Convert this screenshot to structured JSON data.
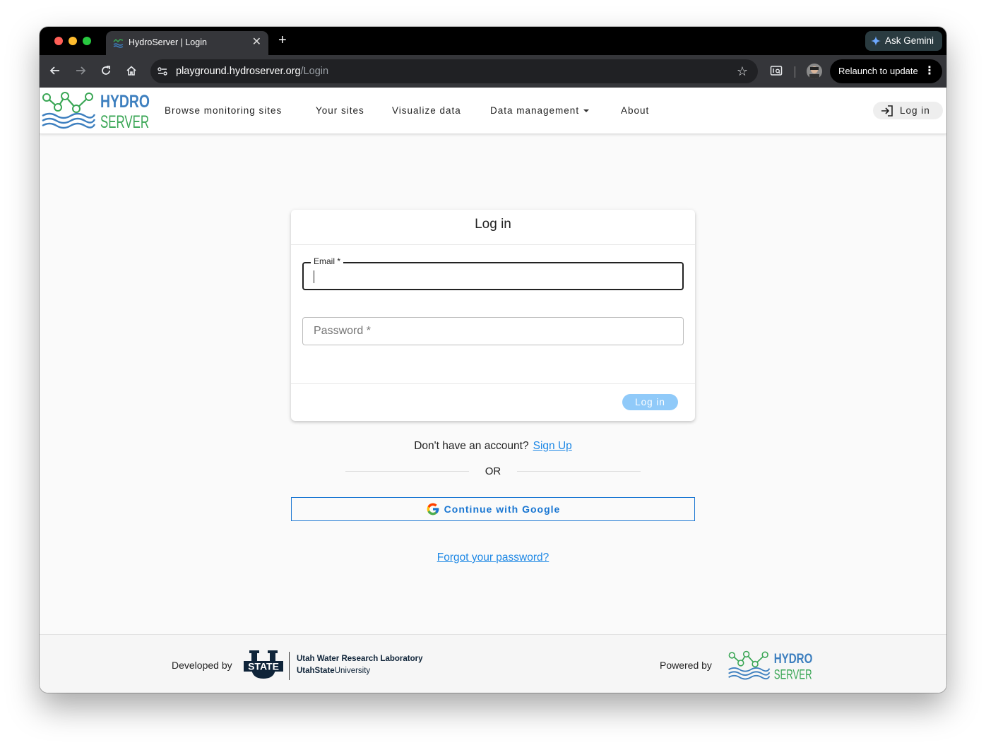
{
  "browser": {
    "tab_title": "HydroServer | Login",
    "tab_close": "✕",
    "new_tab": "+",
    "gemini_label": "Ask Gemini",
    "url_host": "playground.hydroserver.org",
    "url_path": "/Login",
    "relaunch_label": "Relaunch to update",
    "relaunch_menu": "⋮",
    "star": "☆"
  },
  "logo": {
    "line1": "HYDRO",
    "line2": "SERVER"
  },
  "nav": {
    "items": [
      {
        "label": "Browse monitoring sites"
      },
      {
        "label": "Your sites"
      },
      {
        "label": "Visualize data"
      },
      {
        "label": "Data management"
      },
      {
        "label": "About"
      }
    ],
    "login_label": "Log in"
  },
  "login_card": {
    "title": "Log in",
    "email_label": "Email *",
    "password_label": "Password *",
    "submit_label": "Log in"
  },
  "signup": {
    "prompt": "Don't have an account?",
    "link": "Sign Up"
  },
  "or_text": "OR",
  "google_button": "Continue with Google",
  "forgot_password": "Forgot your password?",
  "footer": {
    "developed_by": "Developed by",
    "usu_state": "STATE",
    "usu_lab": "Utah Water Research Laboratory",
    "usu_univ_bold": "UtahState",
    "usu_univ": "University",
    "powered_by": "Powered by"
  },
  "colors": {
    "link_blue": "#1e88e5",
    "logo_blue": "#3d7fbf",
    "logo_green": "#3aa655",
    "login_disabled": "#90caf9"
  }
}
